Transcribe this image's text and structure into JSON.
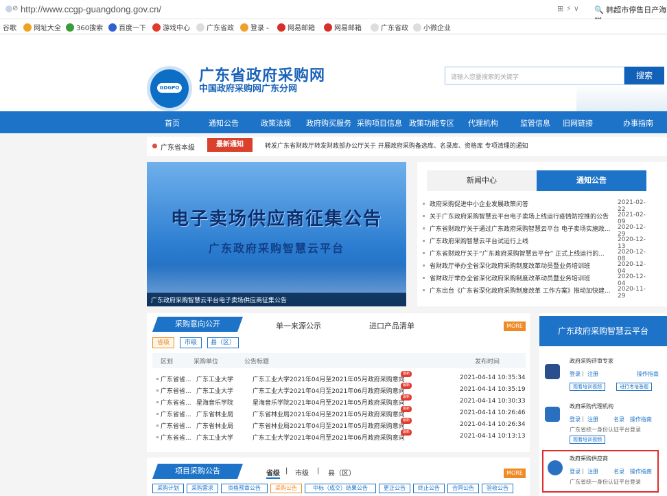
{
  "browser": {
    "url": "http://www.ccgp-guangdong.gov.cn/",
    "search_text": "韩超市停售日产海鲜",
    "bookmarks": [
      "谷歌",
      "网址大全",
      "360搜索",
      "百度一下",
      "游戏中心",
      "广东省政",
      "登录 -",
      "网易邮箱",
      "网易邮箱",
      "广东省政",
      "小微企业"
    ]
  },
  "header": {
    "logo_text": "GDGPO",
    "title": "广东省政府采购网",
    "subtitle": "中国政府采购网广东分网",
    "search_placeholder": "请输入您要搜索的关键字",
    "search_button": "搜索"
  },
  "nav": [
    "首页",
    "通知公告",
    "政策法规",
    "政府购买服务",
    "采购项目信息",
    "政策功能专区",
    "代理机构",
    "监管信息",
    "旧网链接",
    "办事指南"
  ],
  "notice_bar": {
    "location": "广东省本级",
    "badge": "最新通知",
    "text": "转发广东省财政厅转发财政部办公厅关于 开展政府采购备选库、名录库、资格库 专项清理的通知"
  },
  "banner": {
    "headline": "电子卖场供应商征集公告",
    "subheadline": "广东政府采购智慧云平台",
    "caption": "广东政府采购智慧云平台电子卖场供应商征集公告"
  },
  "news": {
    "tab_news": "新闻中心",
    "tab_notice": "通知公告",
    "items": [
      {
        "title": "政府采购促进中小企业发展政策问答",
        "date": "2021-02-22"
      },
      {
        "title": "关于广东政府采购智慧云平台电子卖场上线运行疫情防控推的公告",
        "date": "2021-02-09"
      },
      {
        "title": "广东省财政厅关于通过广东政府采购智慧云平台 电子卖场实施政...",
        "date": "2020-12-29"
      },
      {
        "title": "广东政府采购智慧云平台试运行上线",
        "date": "2020-12-13"
      },
      {
        "title": "广东省财政厅关于“广东政府采购智慧云平台” 正式上线运行的...",
        "date": "2020-12-08"
      },
      {
        "title": "省财政厅举办全省深化政府采购制度改革动员暨业务培训班",
        "date": "2020-12-04"
      },
      {
        "title": "省财政厅举办全省深化政府采购制度改革动员暨业务培训班",
        "date": "2020-12-04"
      },
      {
        "title": "广东出台《广东省深化政府采购制度改革 工作方案》推动加快建...",
        "date": "2020-11-29"
      }
    ]
  },
  "procurement": {
    "tabs": [
      "采购意向公开",
      "单一来源公示",
      "进口产品清单"
    ],
    "more": "MORE",
    "levels": [
      "省级",
      "市级",
      "县（区）"
    ],
    "headers": [
      "区划",
      "采购单位",
      "公告标题",
      "发布时间"
    ],
    "new_badge": "最新",
    "rows": [
      {
        "region": "广东省省...",
        "unit": "广东工业大学",
        "title": "广东工业大学2021年04月至2021年05月政府采购意向",
        "time": "2021-04-14 10:35:34"
      },
      {
        "region": "广东省省...",
        "unit": "广东工业大学",
        "title": "广东工业大学2021年04月至2021年06月政府采购意向",
        "time": "2021-04-14 10:35:19"
      },
      {
        "region": "广东省省...",
        "unit": "星海音乐学院",
        "title": "星海音乐学院2021年04月至2021年05月政府采购意向",
        "time": "2021-04-14 10:30:33"
      },
      {
        "region": "广东省省...",
        "unit": "广东省林业局",
        "title": "广东省林业局2021年04月至2021年05月政府采购意向",
        "time": "2021-04-14 10:26:46"
      },
      {
        "region": "广东省省...",
        "unit": "广东省林业局",
        "title": "广东省林业局2021年04月至2021年05月政府采购意向",
        "time": "2021-04-14 10:26:34"
      },
      {
        "region": "广东省省...",
        "unit": "广东工业大学",
        "title": "广东工业大学2021年04月至2021年06月政府采购意向",
        "time": "2021-04-14 10:13:13"
      }
    ]
  },
  "platform": {
    "title": "广东政府采购智慧云平台",
    "expert": {
      "name": "政府采购评审专家",
      "login": "登录",
      "register": "注册",
      "guide": "操作指南",
      "btn1": "观看培训视频",
      "btn2": "进行考培答题"
    },
    "agency": {
      "name": "政府采购代理机构",
      "login": "登录",
      "register": "注册",
      "directory": "名录",
      "guide": "操作指南",
      "note": "广东省统一身份认证平台登录",
      "btn": "观看培训视频"
    },
    "supplier": {
      "name": "政府采购供应商",
      "login": "登录",
      "register": "注册",
      "directory": "名录",
      "guide": "操作指南",
      "note": "广东省统一身份认证平台登录"
    }
  },
  "project": {
    "tab": "项目采购公告",
    "levels": [
      "省级",
      "市级",
      "县（区）"
    ],
    "more": "MORE",
    "categories": [
      "采购计划",
      "采购需求",
      "资格预审公告",
      "采购公告",
      "中标（成交）结果公告",
      "更正公告",
      "终止公告",
      "合同公告",
      "验收公告"
    ]
  },
  "colors": {
    "primary": "#1d73c8",
    "accent": "#f08a25",
    "alert": "#d9412c"
  }
}
